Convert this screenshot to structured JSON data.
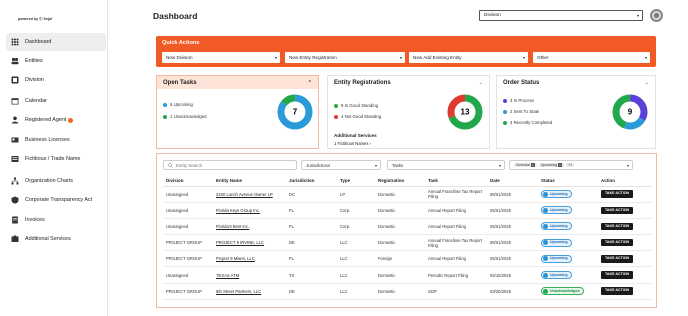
{
  "sidebar": {
    "powered_by": "powered by ⓒ Sejal",
    "items": [
      {
        "label": "Dashboard",
        "icon": "grid-icon",
        "active": true
      },
      {
        "label": "Entities",
        "icon": "entities-icon"
      },
      {
        "label": "Division",
        "icon": "division-icon"
      },
      {
        "label": "Calendar",
        "icon": "calendar-icon"
      },
      {
        "label": "Registered Agent",
        "icon": "agent-icon",
        "badge": true
      },
      {
        "label": "Business Licenses",
        "icon": "license-icon"
      },
      {
        "label": "Fictitious / Trade Name",
        "icon": "trade-name-icon"
      },
      {
        "label": "Organization Charts",
        "icon": "org-chart-icon"
      },
      {
        "label": "Corporate Transparency Act",
        "icon": "cta-icon"
      },
      {
        "label": "Invoices",
        "icon": "invoice-icon"
      },
      {
        "label": "Additional Services",
        "icon": "services-icon"
      }
    ]
  },
  "header": {
    "title": "Dashboard",
    "division_select": "Division"
  },
  "quick_actions": {
    "title": "Quick Actions",
    "selects": [
      "New Division",
      "New Entity Registration",
      "New Add Existing Entity",
      "Other"
    ]
  },
  "open_tasks": {
    "title": "Open Tasks",
    "legend": [
      {
        "label": "6 Upcoming",
        "color": "#2a9bd8"
      },
      {
        "label": "1 Unacknowledged",
        "color": "#22a84a"
      }
    ],
    "total": "7",
    "segments": [
      6,
      1
    ]
  },
  "entity_registrations": {
    "title": "Entity Registrations",
    "legend": [
      {
        "label": "9 In Good Standing",
        "color": "#22a84a"
      },
      {
        "label": "4 Not Good Standing",
        "color": "#e03a2f"
      }
    ],
    "total": "13",
    "segments": [
      9,
      4
    ],
    "additional_services_title": "Additional Services",
    "additional_services_link": "1 Fictitious Names"
  },
  "order_status": {
    "title": "Order Status",
    "legend": [
      {
        "label": "3 In Process",
        "color": "#5b3fd6"
      },
      {
        "label": "2 Sent To State",
        "color": "#2a9bd8"
      },
      {
        "label": "4 Recently Completed",
        "color": "#22a84a"
      }
    ],
    "total": "9",
    "segments": [
      3,
      2,
      4
    ]
  },
  "filters": {
    "search_placeholder": "Entity Search",
    "jurisdictions": "Jurisdictions",
    "tasks": "Tasks",
    "status_chips": [
      "Overdue",
      "Upcoming"
    ],
    "status_more": "+1"
  },
  "table": {
    "headers": [
      "Division",
      "Entity Name",
      "Jurisdiction",
      "Type",
      "Registration",
      "Task",
      "Date",
      "Status",
      "Action"
    ],
    "rows": [
      {
        "division": "Unassigned",
        "entity": "2100 Lunch Avenue Owner LP",
        "jurisdiction": "DC",
        "type": "LP",
        "registration": "Domestic",
        "task": "Annual Franchise Tax Report Filing",
        "date": "06/01/2025",
        "status": "Upcoming",
        "action": "TAKE ACTION"
      },
      {
        "division": "Unassigned",
        "entity": "Florida Keys Group Inc.",
        "jurisdiction": "FL",
        "type": "Corp.",
        "registration": "Domestic",
        "task": "Annual Report Filing",
        "date": "05/01/2025",
        "status": "Upcoming",
        "action": "TAKE ACTION"
      },
      {
        "division": "Unassigned",
        "entity": "Florida's Best Inc.",
        "jurisdiction": "FL",
        "type": "Corp.",
        "registration": "Domestic",
        "task": "Annual Report Filing",
        "date": "05/01/2025",
        "status": "Upcoming",
        "action": "TAKE ACTION"
      },
      {
        "division": "PROJECT GROUP",
        "entity": "PROJECT 9 IRVINE, LLC",
        "jurisdiction": "DE",
        "type": "LLC",
        "registration": "Domestic",
        "task": "Annual Franchise Tax Report Filing",
        "date": "06/01/2025",
        "status": "Upcoming",
        "action": "TAKE ACTION"
      },
      {
        "division": "PROJECT GROUP",
        "entity": "Project 9 Miami, LLC",
        "jurisdiction": "FL",
        "type": "LLC",
        "registration": "Foreign",
        "task": "Annual Report Filing",
        "date": "05/01/2025",
        "status": "Upcoming",
        "action": "TAKE ACTION"
      },
      {
        "division": "Unassigned",
        "entity": "TEXAS ATM",
        "jurisdiction": "TX",
        "type": "LLC",
        "registration": "Domestic",
        "task": "Periodic Report Filing",
        "date": "05/15/2025",
        "status": "Upcoming",
        "action": "TAKE ACTION"
      },
      {
        "division": "PROJECT GROUP",
        "entity": "5th Street Partners, LLC",
        "jurisdiction": "DE",
        "type": "LLC",
        "registration": "Domestic",
        "task": "SOP",
        "date": "03/20/2025",
        "status": "Unacknowledged",
        "action": "TAKE ACTION"
      }
    ]
  },
  "colors": {
    "accent": "#f15a24",
    "upcoming": "#2a9bd8",
    "unacknowledged": "#22a84a",
    "not_good": "#e03a2f",
    "in_process": "#5b3fd6"
  }
}
